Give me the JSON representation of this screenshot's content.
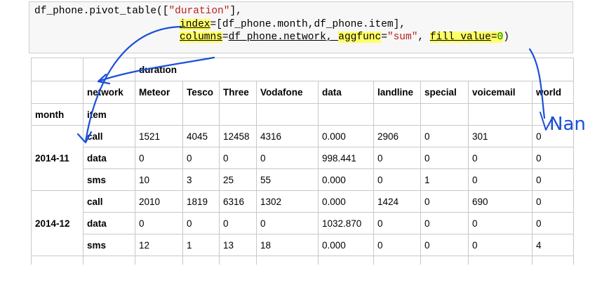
{
  "code": {
    "line1_prefix": "df_phone.pivot_table([",
    "line1_string": "\"duration\"",
    "line1_suffix": "],",
    "line2_kw": "index",
    "line2_eq": "=",
    "line2_rest": "[df_phone.month,df_phone.item",
    "line2_close": "],",
    "line3_kw": "columns",
    "line3_eq": "=",
    "line3_mid": "df_phone.network, ",
    "line3_kw2": "aggfunc",
    "line3_eq2": "=",
    "line3_str": "\"sum\"",
    "line3_comma": ", ",
    "line3_kw3": "fill_value",
    "line3_eq3": "=",
    "line3_num": "0",
    "line3_close": ")"
  },
  "table": {
    "header_values_label": "duration",
    "columns_axis_label": "network",
    "columns": [
      "Meteor",
      "Tesco",
      "Three",
      "Vodafone",
      "data",
      "landline",
      "special",
      "voicemail",
      "world"
    ],
    "index_names": [
      "month",
      "item"
    ],
    "groups": [
      {
        "month": "2014-11",
        "rows": [
          {
            "item": "call",
            "values": [
              "1521",
              "4045",
              "12458",
              "4316",
              "0.000",
              "2906",
              "0",
              "301",
              "0"
            ]
          },
          {
            "item": "data",
            "values": [
              "0",
              "0",
              "0",
              "0",
              "998.441",
              "0",
              "0",
              "0",
              "0"
            ]
          },
          {
            "item": "sms",
            "values": [
              "10",
              "3",
              "25",
              "55",
              "0.000",
              "0",
              "1",
              "0",
              "0"
            ]
          }
        ]
      },
      {
        "month": "2014-12",
        "rows": [
          {
            "item": "call",
            "values": [
              "2010",
              "1819",
              "6316",
              "1302",
              "0.000",
              "1424",
              "0",
              "690",
              "0"
            ]
          },
          {
            "item": "data",
            "values": [
              "0",
              "0",
              "0",
              "0",
              "1032.870",
              "0",
              "0",
              "0",
              "0"
            ]
          },
          {
            "item": "sms",
            "values": [
              "12",
              "1",
              "13",
              "18",
              "0.000",
              "0",
              "0",
              "0",
              "4"
            ]
          }
        ]
      }
    ]
  },
  "annotation": {
    "handwritten_note": "Nan",
    "ink_color": "#1a4fd6",
    "highlight_color": "#ffff66"
  }
}
